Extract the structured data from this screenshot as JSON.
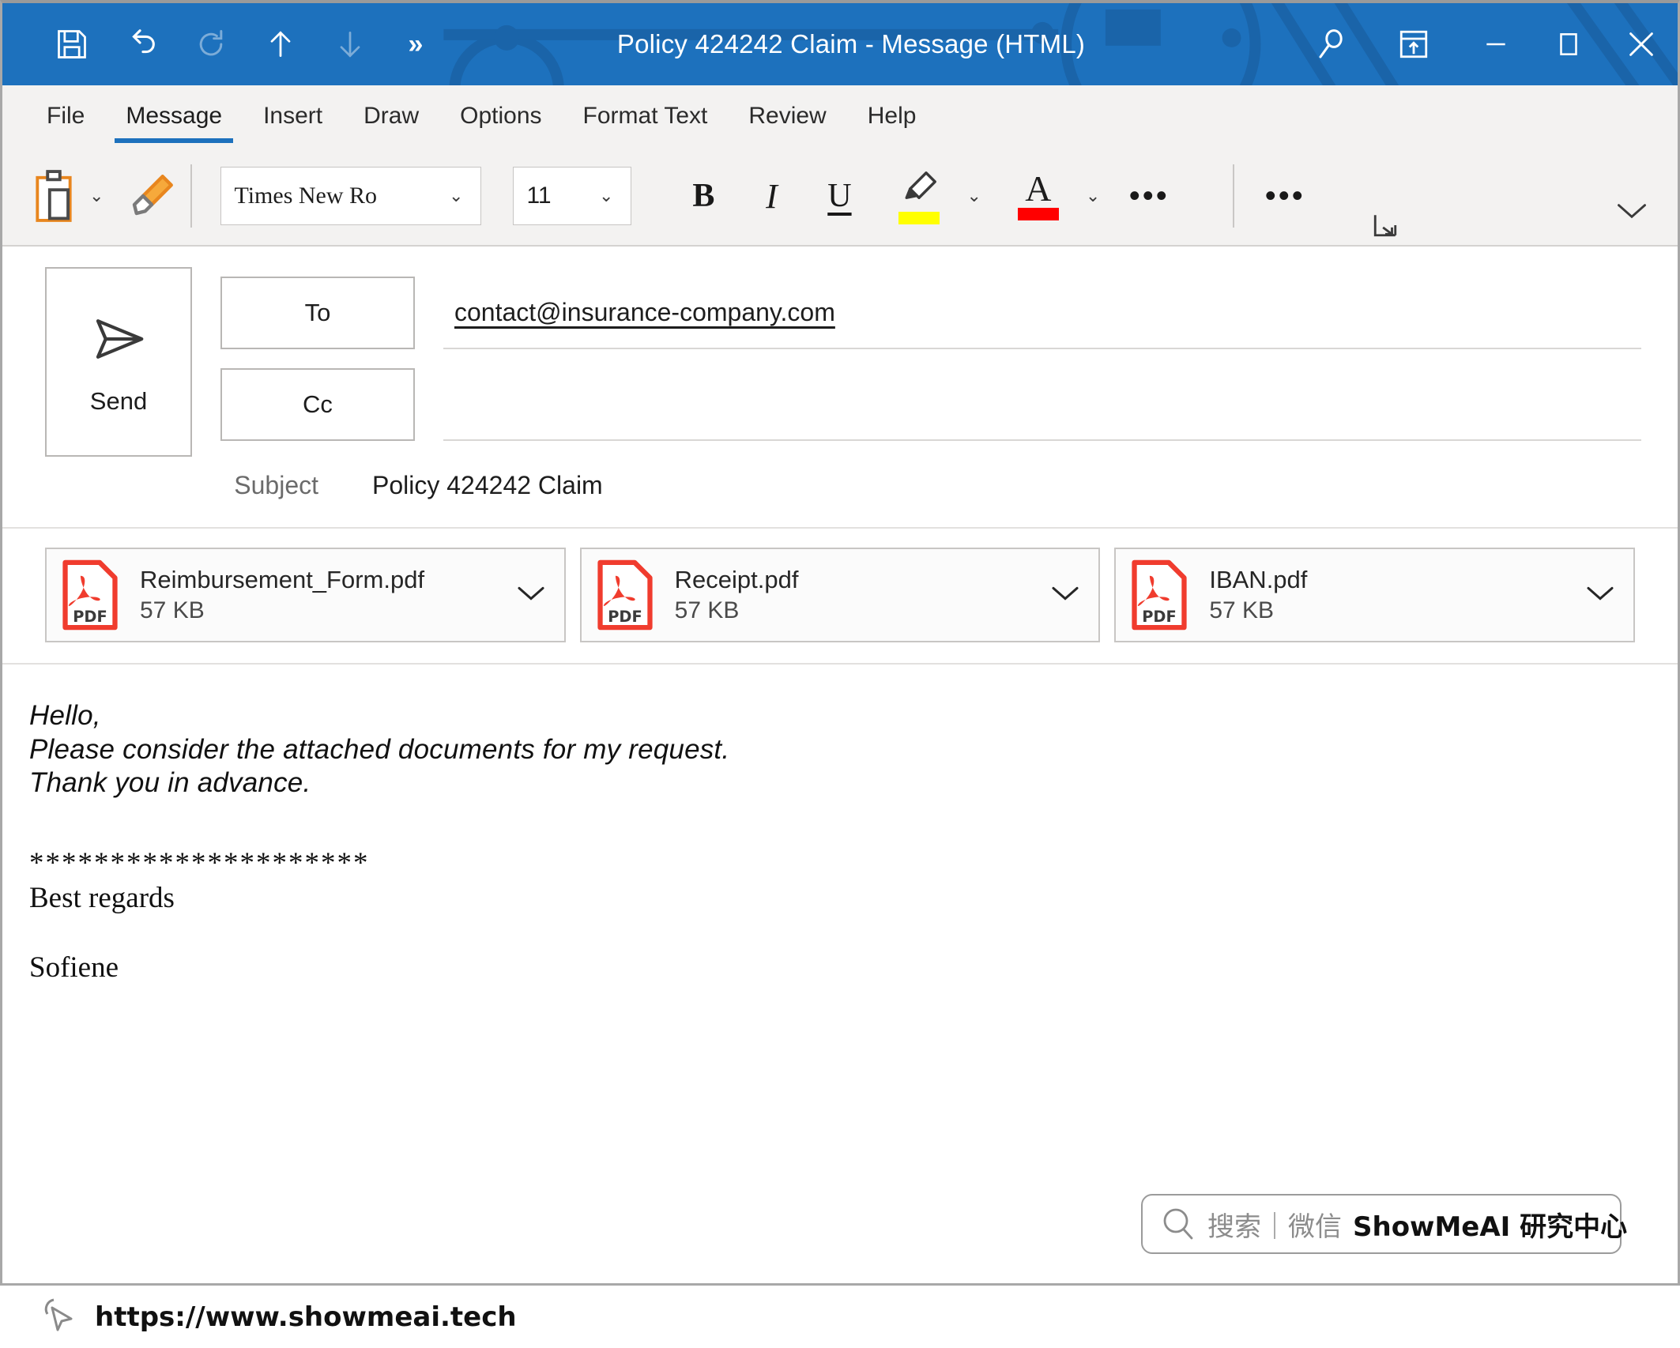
{
  "titlebar": {
    "title": "Policy 424242 Claim  -  Message (HTML)",
    "accent": "#1d71bd",
    "quick_access": [
      {
        "name": "save-icon",
        "label": "Save",
        "enabled": true
      },
      {
        "name": "undo-icon",
        "label": "Undo",
        "enabled": true
      },
      {
        "name": "redo-icon",
        "label": "Redo",
        "enabled": false
      },
      {
        "name": "previous-item-icon",
        "label": "Previous Item",
        "enabled": true
      },
      {
        "name": "next-item-icon",
        "label": "Next Item",
        "enabled": false
      }
    ],
    "overflow_label": "»",
    "window_controls": [
      {
        "name": "search-icon",
        "label": "Search"
      },
      {
        "name": "ribbon-display-options-icon",
        "label": "Ribbon Display Options"
      },
      {
        "name": "minimize-icon",
        "label": "Minimize"
      },
      {
        "name": "maximize-icon",
        "label": "Maximize"
      },
      {
        "name": "close-icon",
        "label": "Close"
      }
    ]
  },
  "ribbon": {
    "tabs": [
      {
        "label": "File",
        "active": false
      },
      {
        "label": "Message",
        "active": true
      },
      {
        "label": "Insert",
        "active": false
      },
      {
        "label": "Draw",
        "active": false
      },
      {
        "label": "Options",
        "active": false
      },
      {
        "label": "Format Text",
        "active": false
      },
      {
        "label": "Review",
        "active": false
      },
      {
        "label": "Help",
        "active": false
      }
    ],
    "toolbar": {
      "paste_label": "Paste",
      "format_painter_label": "Format Painter",
      "font_name": "Times New Ro",
      "font_size": "11",
      "bold_label": "B",
      "italic_label": "I",
      "underline_label": "U",
      "highlight_label": "A",
      "highlight_color": "#ffff00",
      "font_color_label": "A",
      "font_color": "#ff0000",
      "more_label": "•••",
      "overflow_label": "•••"
    }
  },
  "compose": {
    "send_label": "Send",
    "to_label": "To",
    "cc_label": "Cc",
    "to_value": "contact@insurance-company.com",
    "cc_value": "",
    "subject_label": "Subject",
    "subject_value": "Policy 424242 Claim"
  },
  "attachments": [
    {
      "name": "Reimbursement_Form.pdf",
      "size": "57 KB",
      "type": "PDF"
    },
    {
      "name": "Receipt.pdf",
      "size": "57 KB",
      "type": "PDF"
    },
    {
      "name": "IBAN.pdf",
      "size": "57 KB",
      "type": "PDF"
    }
  ],
  "body": {
    "line1": "Hello,",
    "line2": "Please consider the attached documents for my request.",
    "line3": "Thank you in advance.",
    "separator": "*********************",
    "signoff": "Best regards",
    "signature": "Sofiene"
  },
  "watermark": {
    "search_text": "搜索｜微信",
    "brand_text": "ShowMeAI 研究中心"
  },
  "footer": {
    "url": "https://www.showmeai.tech"
  }
}
